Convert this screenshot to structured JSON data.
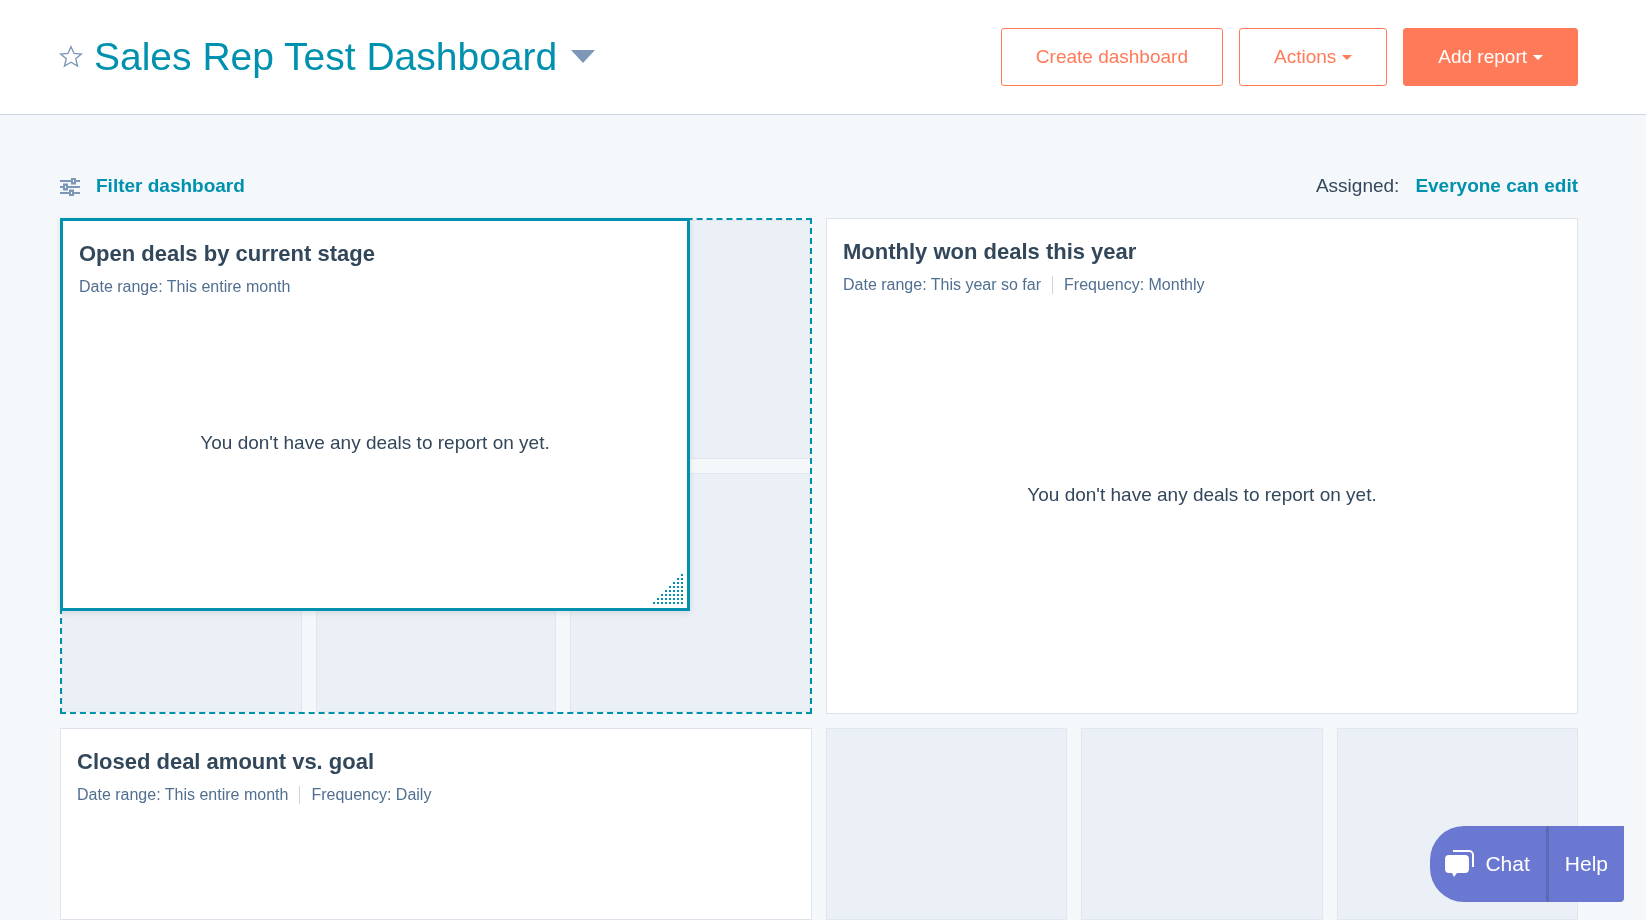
{
  "header": {
    "title": "Sales Rep Test Dashboard",
    "starred": false,
    "buttons": [
      {
        "label": "Create dashboard",
        "kind": "secondary",
        "caret": false
      },
      {
        "label": "Actions",
        "kind": "secondary",
        "caret": true
      },
      {
        "label": "Add report",
        "kind": "primary",
        "caret": true
      }
    ]
  },
  "toolbar": {
    "filter": "Filter dashboard",
    "assigned_label": "Assigned:",
    "assigned_value": "Everyone can edit"
  },
  "reports": [
    {
      "title": "Open deals by current stage",
      "meta": [
        "Date range: This entire month"
      ],
      "message": "You don't have any deals to report on yet.",
      "dragging": true
    },
    {
      "title": "Monthly won deals this year",
      "meta": [
        "Date range: This year so far",
        "Frequency: Monthly"
      ],
      "message": "You don't have any deals to report on yet.",
      "dragging": false
    },
    {
      "title": "Closed deal amount vs. goal",
      "meta": [
        "Date range: This entire month",
        "Frequency: Daily"
      ],
      "dragging": false
    }
  ],
  "support": {
    "chat": "Chat",
    "help": "Help"
  }
}
